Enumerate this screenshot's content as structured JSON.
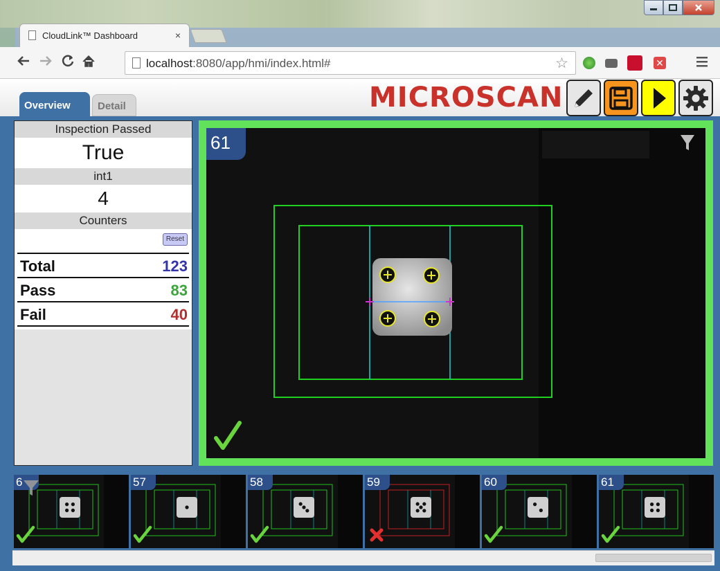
{
  "browser": {
    "tab_title": "CloudLink™ Dashboard",
    "tab_close": "×",
    "url_host": "localhost",
    "url_rest": ":8080/app/hmi/index.html#"
  },
  "app": {
    "tabs": [
      {
        "label": "Overview",
        "active": true
      },
      {
        "label": "Detail",
        "active": false
      }
    ],
    "logo_text": "MICROSCAN",
    "toolbar": {
      "edit_icon": "pencil-icon",
      "save_icon": "save-icon",
      "run_icon": "play-icon",
      "settings_icon": "gear-icon"
    }
  },
  "left_panel": {
    "inspection_label": "Inspection Passed",
    "inspection_value": "True",
    "int1_label": "int1",
    "int1_value": "4",
    "counters_label": "Counters",
    "reset_label": "Reset",
    "counters": [
      {
        "label": "Total",
        "value": "123",
        "color": "#3333aa"
      },
      {
        "label": "Pass",
        "value": "83",
        "color": "#3aa53a"
      },
      {
        "label": "Fail",
        "value": "40",
        "color": "#b03030"
      }
    ]
  },
  "viewer": {
    "frame_number": "61",
    "status": "pass",
    "status_color": "#62e25b",
    "filter_icon": "filter-icon"
  },
  "filmstrip": [
    {
      "num": "6",
      "status": "pass",
      "pips": 4
    },
    {
      "num": "57",
      "status": "pass",
      "pips": 1
    },
    {
      "num": "58",
      "status": "pass",
      "pips": 3
    },
    {
      "num": "59",
      "status": "fail",
      "pips": 5
    },
    {
      "num": "60",
      "status": "pass",
      "pips": 2
    },
    {
      "num": "61",
      "status": "pass",
      "pips": 4
    }
  ]
}
